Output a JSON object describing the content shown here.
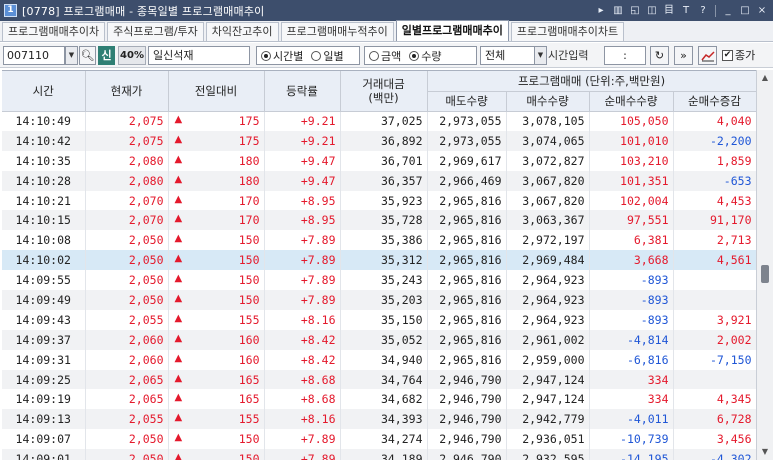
{
  "window": {
    "badge": "1",
    "title": "[0778] 프로그램매매 - 종목일별 프로그램매매추이",
    "buttons": [
      "▸",
      "▥",
      "◱",
      "◫",
      "目",
      "T",
      "?",
      "_",
      "□",
      "×"
    ]
  },
  "tabs": [
    {
      "label": "프로그램매매추이차",
      "active": false
    },
    {
      "label": "주식프로그램/투자",
      "active": false
    },
    {
      "label": "차익잔고추이",
      "active": false
    },
    {
      "label": "프로그램매매누적추이",
      "active": false
    },
    {
      "label": "일별프로그램매매추이",
      "active": true
    },
    {
      "label": "프로그램매매추이차트",
      "active": false
    }
  ],
  "toolbar": {
    "code": "007110",
    "new_badge": "신",
    "pct": "40%",
    "stock_name": "일신석재",
    "period_options": [
      {
        "label": "시간별",
        "selected": true
      },
      {
        "label": "일별",
        "selected": false
      }
    ],
    "unit_options": [
      {
        "label": "금액",
        "selected": false
      },
      {
        "label": "수량",
        "selected": true
      }
    ],
    "filter_value": "전체",
    "time_label": "시간입력",
    "time_value": ":",
    "volume_label": "종가",
    "volume_checked": "✔"
  },
  "table": {
    "headers": {
      "time": "시간",
      "price": "현재가",
      "change": "전일대비",
      "rate": "등락률",
      "amount": "거래대금",
      "amount_unit": "(백만)",
      "program_group": "프로그램매매 (단위:주,백만원)",
      "sell": "매도수량",
      "buy": "매수수량",
      "net": "순매수수량",
      "net_delta": "순매수증감"
    },
    "rows": [
      {
        "time": "14:10:49",
        "price": "2,075",
        "arrow": "▲",
        "change": "175",
        "rate": "+9.21",
        "amount": "37,025",
        "sell": "2,973,055",
        "buy": "3,078,105",
        "net": "105,050",
        "net_color": "red",
        "delta": "4,040",
        "delta_color": "red"
      },
      {
        "time": "14:10:42",
        "price": "2,075",
        "arrow": "▲",
        "change": "175",
        "rate": "+9.21",
        "amount": "36,892",
        "sell": "2,973,055",
        "buy": "3,074,065",
        "net": "101,010",
        "net_color": "red",
        "delta": "-2,200",
        "delta_color": "blue"
      },
      {
        "time": "14:10:35",
        "price": "2,080",
        "arrow": "▲",
        "change": "180",
        "rate": "+9.47",
        "amount": "36,701",
        "sell": "2,969,617",
        "buy": "3,072,827",
        "net": "103,210",
        "net_color": "red",
        "delta": "1,859",
        "delta_color": "red"
      },
      {
        "time": "14:10:28",
        "price": "2,080",
        "arrow": "▲",
        "change": "180",
        "rate": "+9.47",
        "amount": "36,357",
        "sell": "2,966,469",
        "buy": "3,067,820",
        "net": "101,351",
        "net_color": "red",
        "delta": "-653",
        "delta_color": "blue"
      },
      {
        "time": "14:10:21",
        "price": "2,070",
        "arrow": "▲",
        "change": "170",
        "rate": "+8.95",
        "amount": "35,923",
        "sell": "2,965,816",
        "buy": "3,067,820",
        "net": "102,004",
        "net_color": "red",
        "delta": "4,453",
        "delta_color": "red"
      },
      {
        "time": "14:10:15",
        "price": "2,070",
        "arrow": "▲",
        "change": "170",
        "rate": "+8.95",
        "amount": "35,728",
        "sell": "2,965,816",
        "buy": "3,063,367",
        "net": "97,551",
        "net_color": "red",
        "delta": "91,170",
        "delta_color": "red"
      },
      {
        "time": "14:10:08",
        "price": "2,050",
        "arrow": "▲",
        "change": "150",
        "rate": "+7.89",
        "amount": "35,386",
        "sell": "2,965,816",
        "buy": "2,972,197",
        "net": "6,381",
        "net_color": "red",
        "delta": "2,713",
        "delta_color": "red"
      },
      {
        "time": "14:10:02",
        "price": "2,050",
        "arrow": "▲",
        "change": "150",
        "rate": "+7.89",
        "amount": "35,312",
        "sell": "2,965,816",
        "buy": "2,969,484",
        "net": "3,668",
        "net_color": "red",
        "delta": "4,561",
        "delta_color": "red"
      },
      {
        "time": "14:09:55",
        "price": "2,050",
        "arrow": "▲",
        "change": "150",
        "rate": "+7.89",
        "amount": "35,243",
        "sell": "2,965,816",
        "buy": "2,964,923",
        "net": "-893",
        "net_color": "blue",
        "delta": "",
        "delta_color": "dark"
      },
      {
        "time": "14:09:49",
        "price": "2,050",
        "arrow": "▲",
        "change": "150",
        "rate": "+7.89",
        "amount": "35,203",
        "sell": "2,965,816",
        "buy": "2,964,923",
        "net": "-893",
        "net_color": "blue",
        "delta": "",
        "delta_color": "dark"
      },
      {
        "time": "14:09:43",
        "price": "2,055",
        "arrow": "▲",
        "change": "155",
        "rate": "+8.16",
        "amount": "35,150",
        "sell": "2,965,816",
        "buy": "2,964,923",
        "net": "-893",
        "net_color": "blue",
        "delta": "3,921",
        "delta_color": "red"
      },
      {
        "time": "14:09:37",
        "price": "2,060",
        "arrow": "▲",
        "change": "160",
        "rate": "+8.42",
        "amount": "35,052",
        "sell": "2,965,816",
        "buy": "2,961,002",
        "net": "-4,814",
        "net_color": "blue",
        "delta": "2,002",
        "delta_color": "red"
      },
      {
        "time": "14:09:31",
        "price": "2,060",
        "arrow": "▲",
        "change": "160",
        "rate": "+8.42",
        "amount": "34,940",
        "sell": "2,965,816",
        "buy": "2,959,000",
        "net": "-6,816",
        "net_color": "blue",
        "delta": "-7,150",
        "delta_color": "blue"
      },
      {
        "time": "14:09:25",
        "price": "2,065",
        "arrow": "▲",
        "change": "165",
        "rate": "+8.68",
        "amount": "34,764",
        "sell": "2,946,790",
        "buy": "2,947,124",
        "net": "334",
        "net_color": "red",
        "delta": "",
        "delta_color": "dark"
      },
      {
        "time": "14:09:19",
        "price": "2,065",
        "arrow": "▲",
        "change": "165",
        "rate": "+8.68",
        "amount": "34,682",
        "sell": "2,946,790",
        "buy": "2,947,124",
        "net": "334",
        "net_color": "red",
        "delta": "4,345",
        "delta_color": "red"
      },
      {
        "time": "14:09:13",
        "price": "2,055",
        "arrow": "▲",
        "change": "155",
        "rate": "+8.16",
        "amount": "34,393",
        "sell": "2,946,790",
        "buy": "2,942,779",
        "net": "-4,011",
        "net_color": "blue",
        "delta": "6,728",
        "delta_color": "red"
      },
      {
        "time": "14:09:07",
        "price": "2,050",
        "arrow": "▲",
        "change": "150",
        "rate": "+7.89",
        "amount": "34,274",
        "sell": "2,946,790",
        "buy": "2,936,051",
        "net": "-10,739",
        "net_color": "blue",
        "delta": "3,456",
        "delta_color": "red"
      },
      {
        "time": "14:09:01",
        "price": "2,050",
        "arrow": "▲",
        "change": "150",
        "rate": "+7.89",
        "amount": "34,189",
        "sell": "2,946,790",
        "buy": "2,932,595",
        "net": "-14,195",
        "net_color": "blue",
        "delta": "-4,302",
        "delta_color": "blue"
      }
    ],
    "selected_row": 7
  }
}
